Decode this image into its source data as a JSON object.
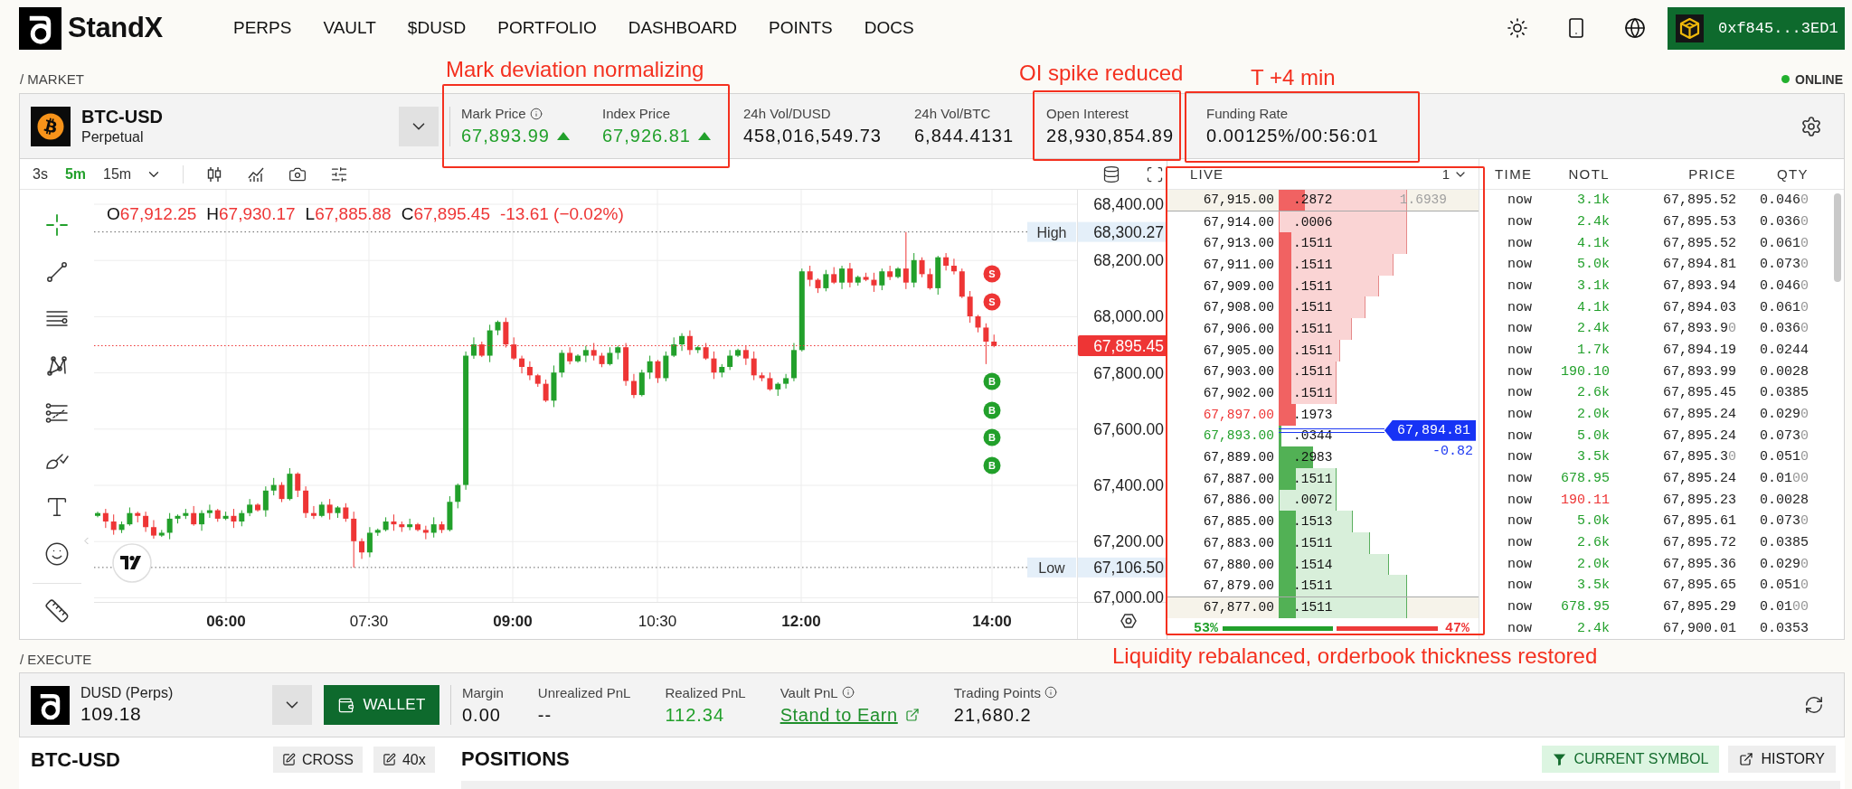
{
  "nav": {
    "brand": "StandX",
    "links": [
      "PERPS",
      "VAULT",
      "$DUSD",
      "PORTFOLIO",
      "DASHBOARD",
      "POINTS",
      "DOCS"
    ],
    "wallet": "0xf845...3ED1"
  },
  "market_section": {
    "label": "/ MARKET",
    "status": {
      "label": "ONLINE",
      "connected": true
    }
  },
  "market": {
    "symbol": "BTC-USD",
    "type": "Perpetual",
    "stats": [
      {
        "label": "Mark Price",
        "value": "67,893.99",
        "info": true,
        "rising": true
      },
      {
        "label": "Index Price",
        "value": "67,926.81",
        "info": false,
        "rising": true
      },
      {
        "label": "24h Vol/DUSD",
        "value": "458,016,549.73",
        "info": false,
        "rising": false
      },
      {
        "label": "24h Vol/BTC",
        "value": "6,844.4131",
        "info": false,
        "rising": false
      },
      {
        "label": "Open Interest",
        "value": "28,930,854.89",
        "info": false,
        "rising": false
      },
      {
        "label": "Funding Rate",
        "value": "0.00125%/00:56:01",
        "info": false,
        "rising": false
      }
    ]
  },
  "chart": {
    "intervals": [
      {
        "label": "3s",
        "selected": false
      },
      {
        "label": "5m",
        "selected": true
      },
      {
        "label": "15m",
        "selected": false
      }
    ],
    "falling": true,
    "legend": [
      {
        "key": "O",
        "value": "67,912.25"
      },
      {
        "key": "H",
        "value": "67,930.17"
      },
      {
        "key": "L",
        "value": "67,885.88"
      },
      {
        "key": "C",
        "value": "67,895.45"
      }
    ],
    "change": "-13.61 (−0.02%)",
    "price_labels": [
      "68,400.00",
      "68,200.00",
      "68,000.00",
      "67,800.00",
      "67,600.00",
      "67,400.00",
      "67,200.00",
      "67,000.00"
    ],
    "time_labels": [
      {
        "label": "06:00",
        "major": true
      },
      {
        "label": "07:30",
        "major": false
      },
      {
        "label": "09:00",
        "major": true
      },
      {
        "label": "10:30",
        "major": false
      },
      {
        "label": "12:00",
        "major": true
      },
      {
        "label": "14:00",
        "major": true
      }
    ],
    "high": {
      "label": "High",
      "value": "68,300.27"
    },
    "low": {
      "label": "Low",
      "value": "67,106.50"
    },
    "last_price": "67,895.45",
    "trade_markers": [
      {
        "label": "S",
        "sell": true
      },
      {
        "label": "S",
        "sell": true
      },
      {
        "label": "B",
        "sell": false
      },
      {
        "label": "B",
        "sell": false
      },
      {
        "label": "B",
        "sell": false
      },
      {
        "label": "B",
        "sell": false
      }
    ]
  },
  "order_book": {
    "header": "LIVE",
    "grouping": "1",
    "total": "1.6939",
    "asks": [
      {
        "price": "67,915.00",
        "size": ".2872",
        "highlighted": true,
        "best": false
      },
      {
        "price": "67,914.00",
        "size": ".0006",
        "highlighted": false,
        "best": false
      },
      {
        "price": "67,913.00",
        "size": ".1511",
        "highlighted": false,
        "best": false
      },
      {
        "price": "67,911.00",
        "size": ".1511",
        "highlighted": false,
        "best": false
      },
      {
        "price": "67,909.00",
        "size": ".1511",
        "highlighted": false,
        "best": false
      },
      {
        "price": "67,908.00",
        "size": ".1511",
        "highlighted": false,
        "best": false
      },
      {
        "price": "67,906.00",
        "size": ".1511",
        "highlighted": false,
        "best": false
      },
      {
        "price": "67,905.00",
        "size": ".1511",
        "highlighted": false,
        "best": false
      },
      {
        "price": "67,903.00",
        "size": ".1511",
        "highlighted": false,
        "best": false
      },
      {
        "price": "67,902.00",
        "size": ".1511",
        "highlighted": false,
        "best": false
      },
      {
        "price": "67,897.00",
        "size": ".1973",
        "highlighted": false,
        "best": true
      }
    ],
    "mid": {
      "price": "67,894.81",
      "change": "-0.82"
    },
    "bids": [
      {
        "price": "67,893.00",
        "size": ".0344",
        "highlighted": false,
        "best": true
      },
      {
        "price": "67,889.00",
        "size": ".2983",
        "highlighted": false,
        "best": false
      },
      {
        "price": "67,887.00",
        "size": ".1511",
        "highlighted": false,
        "best": false
      },
      {
        "price": "67,886.00",
        "size": ".0072",
        "highlighted": false,
        "best": false
      },
      {
        "price": "67,885.00",
        "size": ".1513",
        "highlighted": false,
        "best": false
      },
      {
        "price": "67,883.00",
        "size": ".1511",
        "highlighted": false,
        "best": false
      },
      {
        "price": "67,880.00",
        "size": ".1514",
        "highlighted": false,
        "best": false
      },
      {
        "price": "67,879.00",
        "size": ".1511",
        "highlighted": false,
        "best": false
      },
      {
        "price": "67,877.00",
        "size": ".1511",
        "highlighted": true,
        "best": false
      }
    ],
    "ratio": {
      "bid": "53%",
      "ask": "47%",
      "level": 0.53
    }
  },
  "trades": {
    "columns": [
      "TIME",
      "NOTL",
      "PRICE",
      "QTY"
    ],
    "rows": [
      {
        "time": "now",
        "notional": "3.1k",
        "sell": false,
        "price": "67,895.52",
        "qty": "0.046",
        "qty_faded": "0"
      },
      {
        "time": "now",
        "notional": "2.4k",
        "sell": false,
        "price": "67,895.53",
        "qty": "0.036",
        "qty_faded": "0"
      },
      {
        "time": "now",
        "notional": "4.1k",
        "sell": false,
        "price": "67,895.52",
        "qty": "0.061",
        "qty_faded": "0"
      },
      {
        "time": "now",
        "notional": "5.0k",
        "sell": false,
        "price": "67,894.81",
        "qty": "0.073",
        "qty_faded": "0"
      },
      {
        "time": "now",
        "notional": "3.1k",
        "sell": false,
        "price": "67,893.94",
        "qty": "0.046",
        "qty_faded": "0"
      },
      {
        "time": "now",
        "notional": "4.1k",
        "sell": false,
        "price": "67,894.03",
        "qty": "0.061",
        "qty_faded": "0"
      },
      {
        "time": "now",
        "notional": "2.4k",
        "sell": false,
        "price": "67,893.9",
        "price_faded": "0",
        "qty": "0.036",
        "qty_faded": "0"
      },
      {
        "time": "now",
        "notional": "1.7k",
        "sell": false,
        "price": "67,894.19",
        "qty": "0.0244"
      },
      {
        "time": "now",
        "notional": "190.10",
        "sell": false,
        "price": "67,893.99",
        "qty": "0.0028"
      },
      {
        "time": "now",
        "notional": "2.6k",
        "sell": false,
        "price": "67,895.45",
        "qty": "0.0385"
      },
      {
        "time": "now",
        "notional": "2.0k",
        "sell": false,
        "price": "67,895.24",
        "qty": "0.029",
        "qty_faded": "0"
      },
      {
        "time": "now",
        "notional": "5.0k",
        "sell": false,
        "price": "67,895.24",
        "qty": "0.073",
        "qty_faded": "0"
      },
      {
        "time": "now",
        "notional": "3.5k",
        "sell": false,
        "price": "67,895.3",
        "price_faded": "0",
        "qty": "0.051",
        "qty_faded": "0"
      },
      {
        "time": "now",
        "notional": "678.95",
        "sell": false,
        "price": "67,895.24",
        "qty": "0.01",
        "qty_faded": "00"
      },
      {
        "time": "now",
        "notional": "190.11",
        "sell": true,
        "price": "67,895.23",
        "qty": "0.0028"
      },
      {
        "time": "now",
        "notional": "5.0k",
        "sell": false,
        "price": "67,895.61",
        "qty": "0.073",
        "qty_faded": "0"
      },
      {
        "time": "now",
        "notional": "2.6k",
        "sell": false,
        "price": "67,895.72",
        "qty": "0.0385"
      },
      {
        "time": "now",
        "notional": "2.0k",
        "sell": false,
        "price": "67,895.36",
        "qty": "0.029",
        "qty_faded": "0"
      },
      {
        "time": "now",
        "notional": "3.5k",
        "sell": false,
        "price": "67,895.65",
        "qty": "0.051",
        "qty_faded": "0"
      },
      {
        "time": "now",
        "notional": "678.95",
        "sell": false,
        "price": "67,895.29",
        "qty": "0.01",
        "qty_faded": "00"
      },
      {
        "time": "now",
        "notional": "2.4k",
        "sell": false,
        "price": "67,900.01",
        "qty": "0.0353"
      }
    ]
  },
  "execute_section": {
    "label": "/ EXECUTE"
  },
  "account": {
    "asset": "DUSD (Perps)",
    "balance": "109.18",
    "wallet_button": "WALLET",
    "stats": [
      {
        "label": "Margin",
        "value": "0.00",
        "info": false,
        "link": false,
        "positive": false
      },
      {
        "label": "Unrealized PnL",
        "value": "--",
        "info": false,
        "link": false,
        "positive": false
      },
      {
        "label": "Realized PnL",
        "value": "112.34",
        "info": false,
        "link": false,
        "positive": true
      },
      {
        "label": "Vault PnL",
        "value": "Stand to Earn",
        "info": true,
        "link": true,
        "positive": true
      },
      {
        "label": "Trading Points",
        "value": "21,680.2",
        "info": true,
        "link": false,
        "positive": false
      }
    ]
  },
  "positions": {
    "symbol": "BTC-USD",
    "margin_mode": "CROSS",
    "leverage": "40x",
    "title": "POSITIONS",
    "filter": {
      "label": "CURRENT SYMBOL",
      "selected": true
    },
    "history": "HISTORY"
  },
  "annotations": [
    {
      "label": "Mark deviation normalizing"
    },
    {
      "label": "OI spike reduced"
    },
    {
      "label": "T +4 min"
    },
    {
      "label": "Liquidity rebalanced, orderbook thickness restored"
    }
  ]
}
